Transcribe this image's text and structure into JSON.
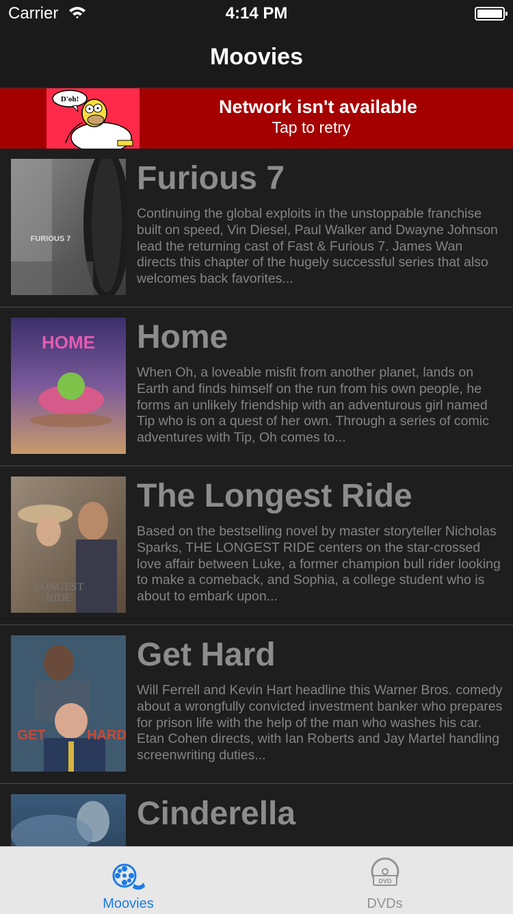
{
  "status_bar": {
    "carrier": "Carrier",
    "time": "4:14 PM"
  },
  "navbar": {
    "title": "Moovies"
  },
  "banner": {
    "bubble": "D'oh!",
    "title": "Network isn't available",
    "subtitle": "Tap to retry"
  },
  "movies": [
    {
      "title": "Furious 7",
      "synopsis": "Continuing the global exploits in the unstoppable franchise built on speed, Vin Diesel, Paul Walker and Dwayne Johnson lead the returning cast of Fast & Furious 7. James Wan directs this chapter of the hugely successful series that also welcomes back favorites..."
    },
    {
      "title": "Home",
      "synopsis": "When Oh, a loveable misfit from another planet, lands on Earth and finds himself on the run from his own people, he forms an unlikely friendship with an adventurous girl named Tip who is on a quest of her own. Through a series of comic adventures with Tip, Oh comes to..."
    },
    {
      "title": "The Longest Ride",
      "synopsis": "Based on the bestselling novel by master storyteller Nicholas Sparks, THE LONGEST RIDE centers on the star-crossed love affair between Luke, a former champion bull rider looking to make a comeback, and Sophia, a college student who is about to embark upon..."
    },
    {
      "title": "Get Hard",
      "synopsis": "Will Ferrell and Kevin Hart headline this Warner Bros. comedy about a wrongfully convicted investment banker who prepares for prison life with the help of the man who washes his car. Etan Cohen directs, with Ian Roberts and Jay Martel handling screenwriting duties..."
    },
    {
      "title": "Cinderella",
      "synopsis": ""
    }
  ],
  "poster_text": {
    "furious": "FURIOUS 7",
    "longest": "LONGEST",
    "ride": "RIDE",
    "get": "GET",
    "hard": "HARD"
  },
  "tabbar": {
    "tabs": [
      {
        "label": "Moovies",
        "icon": "film-reel-icon",
        "active": true
      },
      {
        "label": "DVDs",
        "icon": "dvd-icon",
        "active": false
      }
    ],
    "active_color": "#1a7ce8",
    "inactive_color": "#929292"
  },
  "colors": {
    "banner": "#a50000",
    "background": "#1e1e1e"
  }
}
